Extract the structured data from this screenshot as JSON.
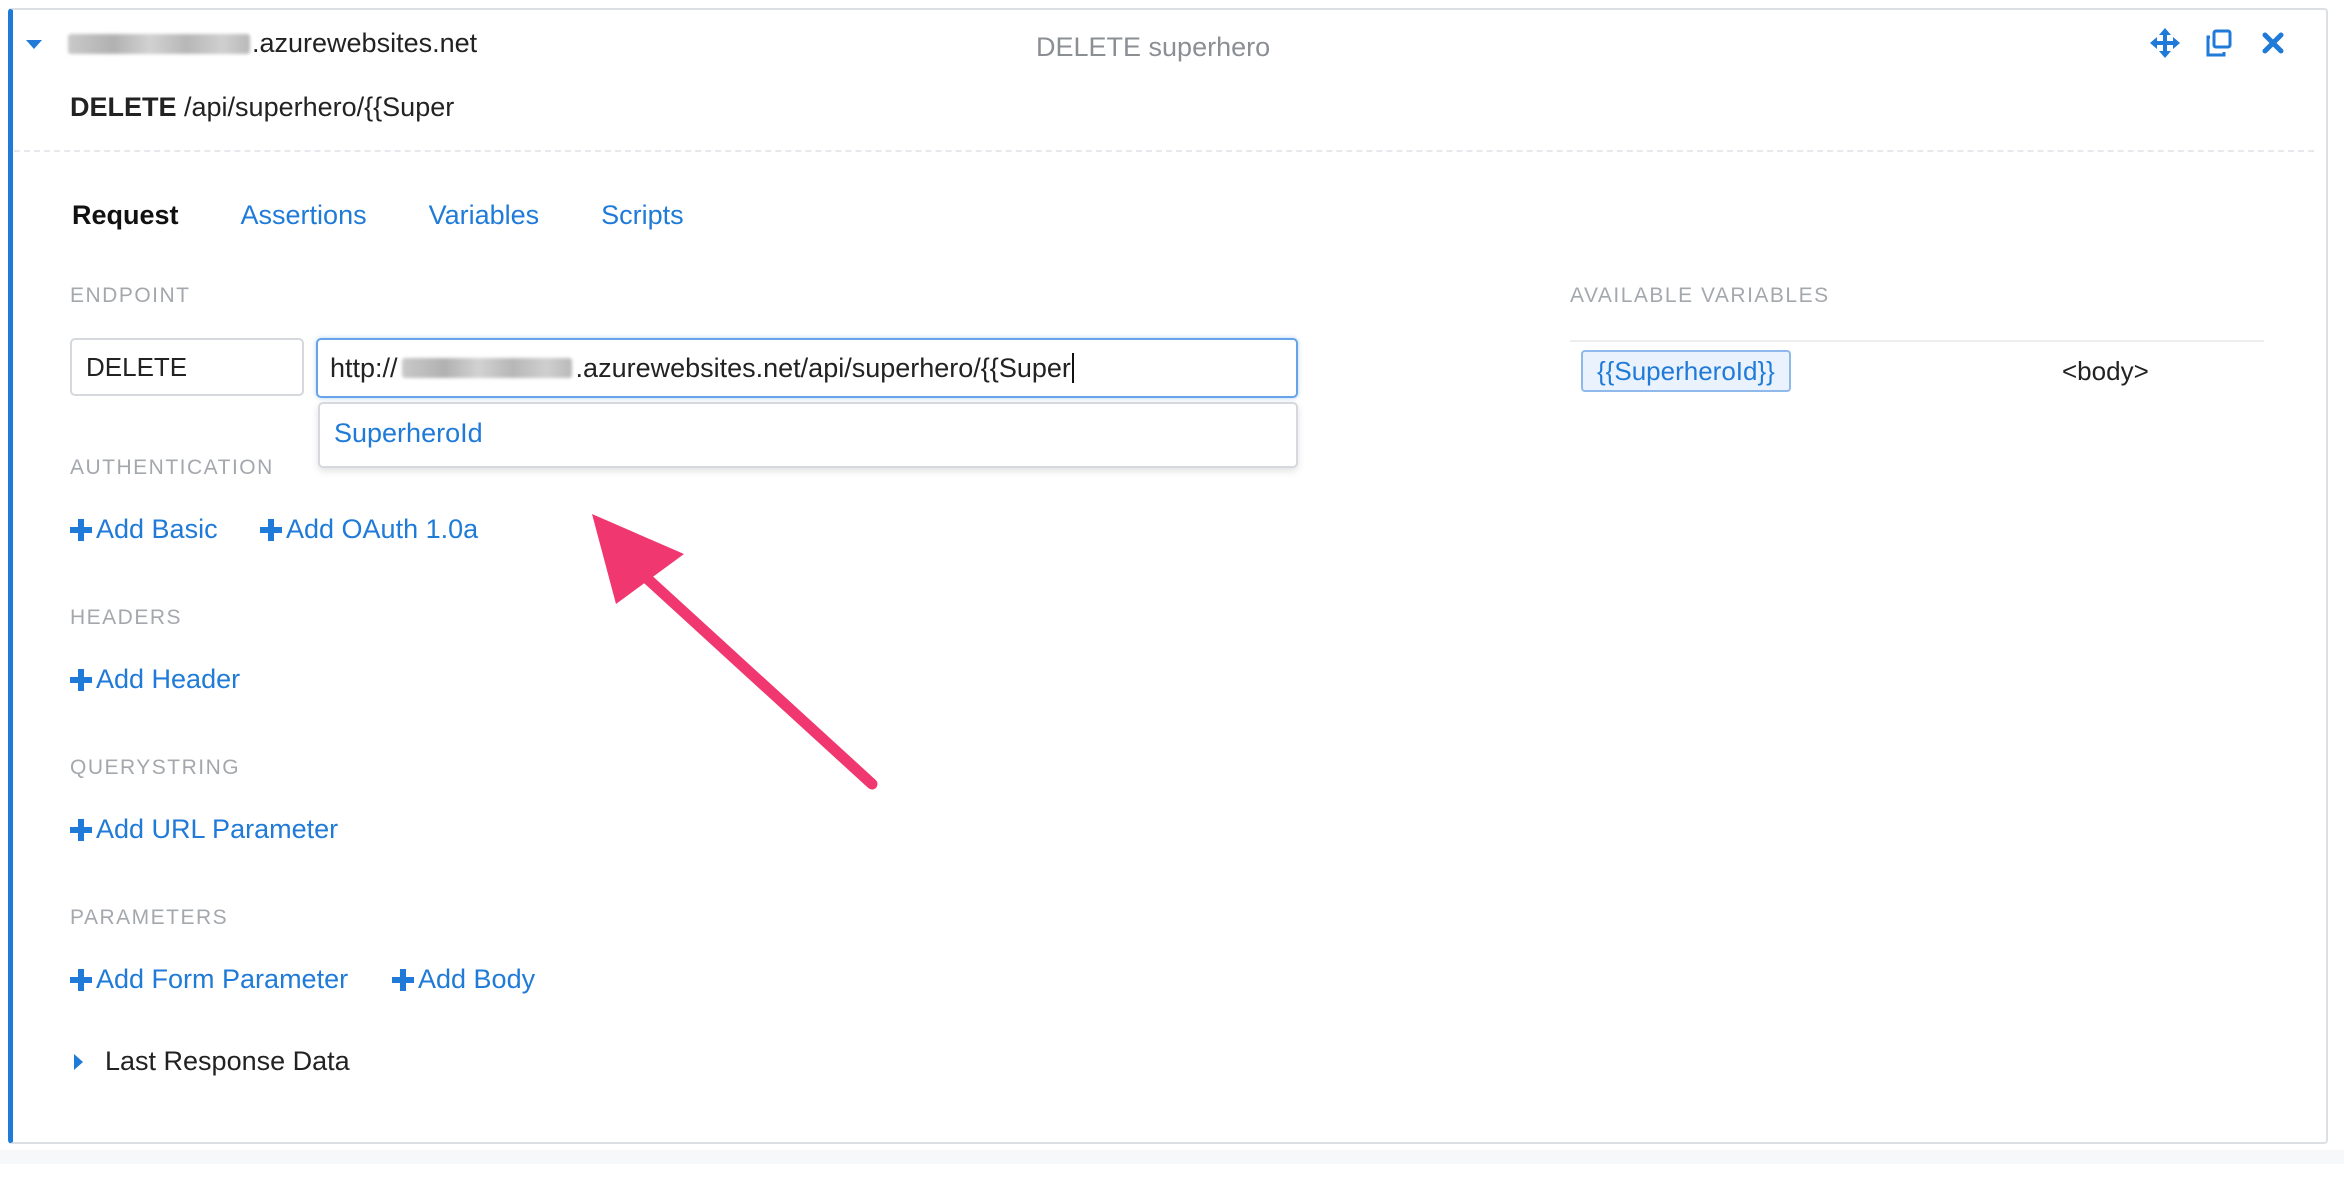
{
  "header": {
    "host_suffix": ".azurewebsites.net",
    "title": "DELETE superhero",
    "method": "DELETE",
    "path": " /api/superhero/{{Super"
  },
  "tabs": [
    {
      "label": "Request",
      "active": true
    },
    {
      "label": "Assertions",
      "active": false
    },
    {
      "label": "Variables",
      "active": false
    },
    {
      "label": "Scripts",
      "active": false
    }
  ],
  "endpoint": {
    "section_label": "ENDPOINT",
    "method_value": "DELETE",
    "url_prefix": "http://",
    "url_suffix": ".azurewebsites.net/api/superhero/{{Super",
    "autocomplete_option": "SuperheroId"
  },
  "authentication": {
    "section_label": "AUTHENTICATION",
    "add_basic": "Add Basic",
    "add_oauth": "Add OAuth 1.0a"
  },
  "headers": {
    "section_label": "HEADERS",
    "add_header": "Add Header"
  },
  "querystring": {
    "section_label": "QUERYSTRING",
    "add_url_parameter": "Add URL Parameter"
  },
  "parameters": {
    "section_label": "PARAMETERS",
    "add_form_parameter": "Add Form Parameter",
    "add_body": "Add Body"
  },
  "last_response": {
    "label": "Last Response Data"
  },
  "available_variables": {
    "section_label": "AVAILABLE VARIABLES",
    "items": [
      {
        "name": "{{SuperheroId}}",
        "value": "<body>"
      }
    ]
  },
  "icons": {
    "collapse": "caret-down-icon",
    "move": "move-arrows-icon",
    "duplicate": "duplicate-icon",
    "close": "close-icon",
    "plus": "plus-icon",
    "expand": "caret-right-icon"
  },
  "colors": {
    "accent": "#1f7ad8",
    "annotation_arrow": "#f0376f",
    "muted_label": "#a4a8ad"
  }
}
